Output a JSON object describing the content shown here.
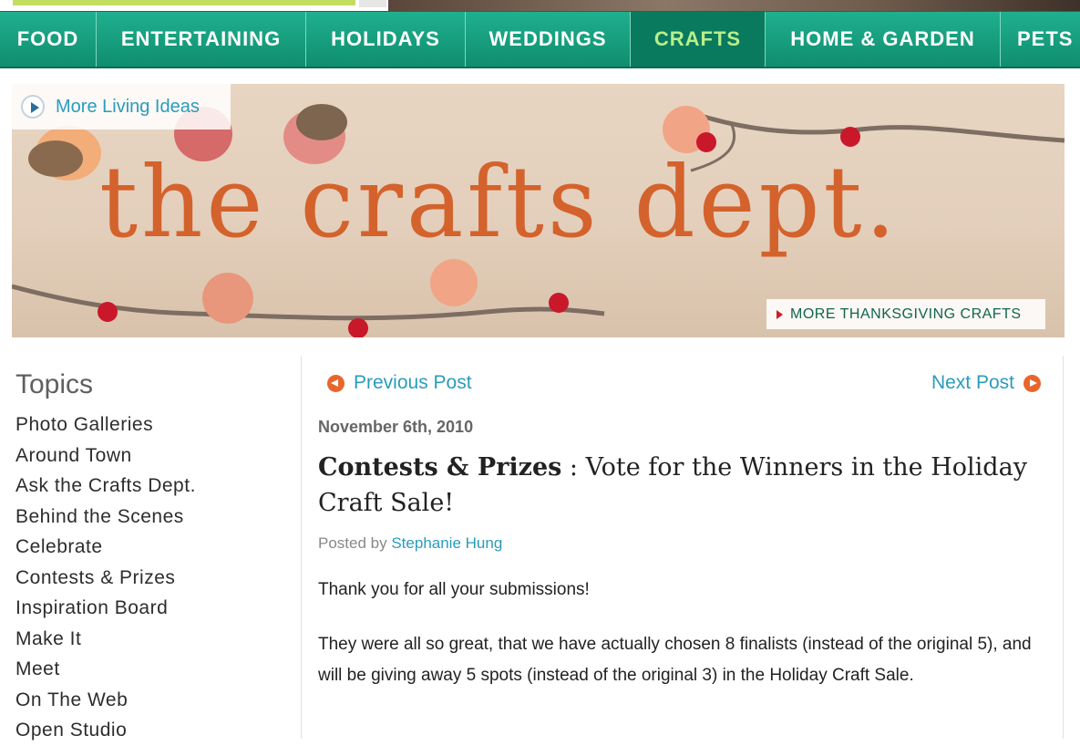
{
  "nav": {
    "items": [
      {
        "label": "FOOD",
        "active": false
      },
      {
        "label": "ENTERTAINING",
        "active": false
      },
      {
        "label": "HOLIDAYS",
        "active": false
      },
      {
        "label": "WEDDINGS",
        "active": false
      },
      {
        "label": "CRAFTS",
        "active": true
      },
      {
        "label": "HOME & GARDEN",
        "active": false
      },
      {
        "label": "PETS",
        "active": false
      }
    ],
    "colors": {
      "bar": "#14a080",
      "active_text": "#b8ef8a",
      "text": "#ffffff"
    }
  },
  "banner": {
    "more_living_ideas": "More Living Ideas",
    "title": "the crafts dept.",
    "more_thanksgiving": "MORE THANKSGIVING CRAFTS"
  },
  "sidebar": {
    "heading": "Topics",
    "topics": [
      "Photo Galleries",
      "Around Town",
      "Ask the Crafts Dept.",
      "Behind the Scenes",
      "Celebrate",
      "Contests & Prizes",
      "Inspiration Board",
      "Make It",
      "Meet",
      "On The Web",
      "Open Studio"
    ]
  },
  "post": {
    "previous": "Previous Post",
    "next": "Next Post",
    "date": "November 6th, 2010",
    "category": "Contests & Prizes",
    "title": " : Vote for the Winners in the Holiday Craft Sale!",
    "posted_by_label": "Posted by",
    "author": "Stephanie Hung",
    "paragraph1": "Thank you for all your submissions!",
    "paragraph2": "They were all so great, that we have actually chosen 8 finalists (instead of the original 5), and will be giving away 5 spots (instead of the original 3) in the Holiday Craft Sale."
  },
  "colors": {
    "link": "#2a9bbd",
    "accent_orange": "#e8662c",
    "banner_text": "#d4622c"
  }
}
